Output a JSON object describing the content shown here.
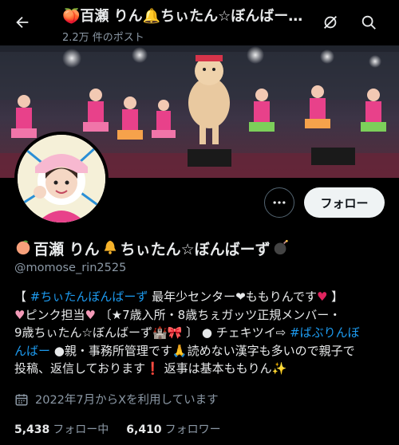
{
  "header": {
    "title": "🍑百瀬 りん🔔ちぃたん☆ぼんばーず💣",
    "subtitle": "2.2万 件のポスト"
  },
  "actions": {
    "follow_label": "フォロー"
  },
  "profile": {
    "name_part1": "百瀬 りん",
    "name_part2": "ちぃたん☆ぼんばーず",
    "handle": "@momose_rin2525",
    "bio_lines": [
      [
        "【 ",
        "#ちぃたんぼんばーず",
        " 最年少センター❤ももりんです",
        " 】"
      ],
      [
        "ピンク担当",
        " 〔★7歳入所・8歳ちぇガッツ正規メンバー・"
      ],
      [
        "9歳ちぃたん☆ぼんばーず",
        " 〕 ● チェキツイ⇨ ",
        "#ばぶりんぼ"
      ],
      [
        "んばー",
        " ●親・事務所管理です",
        "読めない漢字も多いので親子で"
      ],
      [
        "投稿、返信しております",
        " 返事は基本ももりん"
      ]
    ],
    "joined": "2022年7月からXを利用しています"
  },
  "stats": {
    "following_count": "5,438",
    "following_label": "フォロー中",
    "followers_count": "6,410",
    "followers_label": "フォロワー"
  },
  "colors": {
    "background": "#000000",
    "link": "#1d9bf0",
    "muted": "#8b98a5",
    "text": "#e7e9ea"
  },
  "icons": [
    "back-arrow-icon",
    "grok-icon",
    "search-icon",
    "more-icon",
    "calendar-icon"
  ]
}
